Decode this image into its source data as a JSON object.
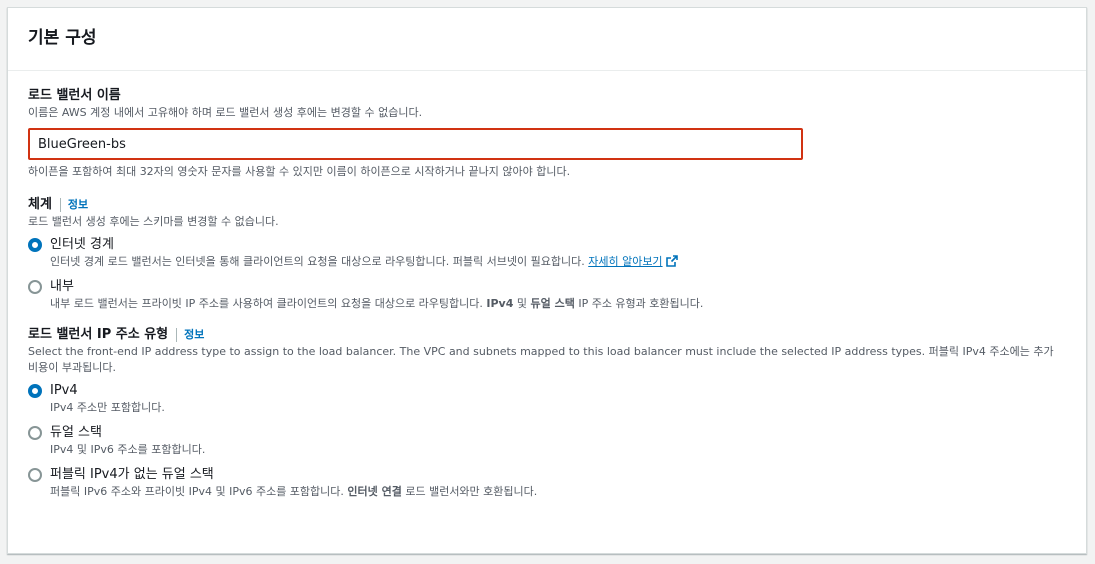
{
  "panel": {
    "title": "기본 구성"
  },
  "name_field": {
    "label": "로드 밸런서 이름",
    "description": "이름은 AWS 계정 내에서 고유해야 하며 로드 밸런서 생성 후에는 변경할 수 없습니다.",
    "value": "BlueGreen-bs",
    "constraint": "하이픈을 포함하여 최대 32자의 영숫자 문자를 사용할 수 있지만 이름이 하이픈으로 시작하거나 끝나지 않아야 합니다."
  },
  "scheme": {
    "label": "체계",
    "info": "정보",
    "description": "로드 밸런서 생성 후에는 스키마를 변경할 수 없습니다.",
    "options": [
      {
        "label": "인터넷 경계",
        "checked": true,
        "description": "인터넷 경계 로드 밸런서는 인터넷을 통해 클라이언트의 요청을 대상으로 라우팅합니다. 퍼블릭 서브넷이 필요합니다.",
        "link": "자세히 알아보기"
      },
      {
        "label": "내부",
        "checked": false,
        "desc_pre": "내부 로드 밸런서는 프라이빗 IP 주소를 사용하여 클라이언트의 요청을 대상으로 라우팅합니다. ",
        "desc_b1": "IPv4",
        "desc_mid": " 및 ",
        "desc_b2": "듀얼 스택",
        "desc_post": " IP 주소 유형과 호환됩니다."
      }
    ]
  },
  "ip_type": {
    "label": "로드 밸런서 IP 주소 유형",
    "info": "정보",
    "description": "Select the front-end IP address type to assign to the load balancer. The VPC and subnets mapped to this load balancer must include the selected IP address types. 퍼블릭 IPv4 주소에는 추가 비용이 부과됩니다.",
    "options": [
      {
        "label": "IPv4",
        "checked": true,
        "description": "IPv4 주소만 포함합니다."
      },
      {
        "label": "듀얼 스택",
        "checked": false,
        "description": "IPv4 및 IPv6 주소를 포함합니다."
      },
      {
        "label": "퍼블릭 IPv4가 없는 듀얼 스택",
        "checked": false,
        "desc_pre": "퍼블릭 IPv6 주소와 프라이빗 IPv4 및 IPv6 주소를 포함합니다. ",
        "desc_b": "인터넷 연결",
        "desc_post": " 로드 밸런서와만 호환됩니다."
      }
    ]
  },
  "colors": {
    "accent": "#0073bb",
    "error_border": "#d13212",
    "text": "#16191f",
    "secondary_text": "#545b64"
  },
  "icons": {
    "external_link": "external-link-icon"
  }
}
